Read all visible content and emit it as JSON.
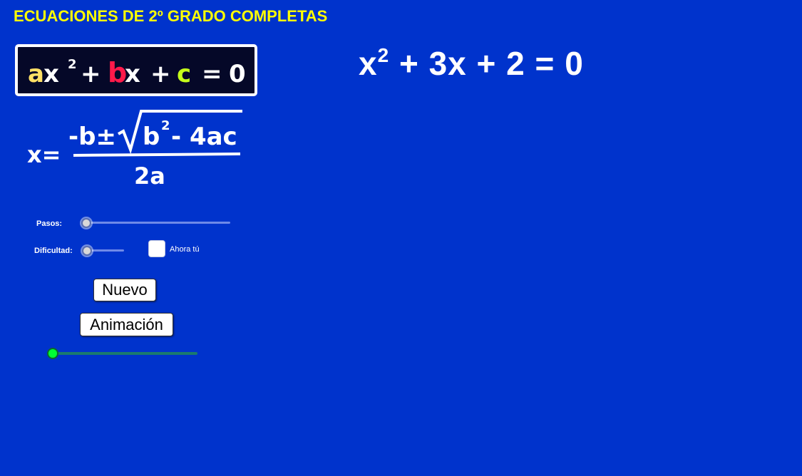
{
  "title": "ECUACIONES DE 2º GRADO COMPLETAS",
  "general_form": {
    "a": "a",
    "x1": "x",
    "exp": "2",
    "plus1": "+",
    "b": "b",
    "x2": "x",
    "plus2": "+",
    "c": "c",
    "eq": "=",
    "zero": "0",
    "color_a": "#ffe066",
    "color_b": "#ff1a4a",
    "color_c": "#c6ff1a",
    "color_rest": "#ffffff"
  },
  "quadratic_formula": {
    "lhs": "x=",
    "numerator_pre": "-b±",
    "radicand_b": "b",
    "radicand_exp": "2",
    "radicand_rest": "- 4ac",
    "denominator": "2a"
  },
  "equation": {
    "part1": "x",
    "exp": "2",
    "part2": " + 3x + 2 = 0"
  },
  "controls": {
    "pasos_label": "Pasos:",
    "pasos_value": 0,
    "dificultad_label": "Dificultad:",
    "dificultad_value": 0,
    "ahora_tu_label": "Ahora tú",
    "ahora_tu_checked": false,
    "nuevo_button": "Nuevo",
    "animacion_button": "Animación",
    "animacion_value": 0
  }
}
